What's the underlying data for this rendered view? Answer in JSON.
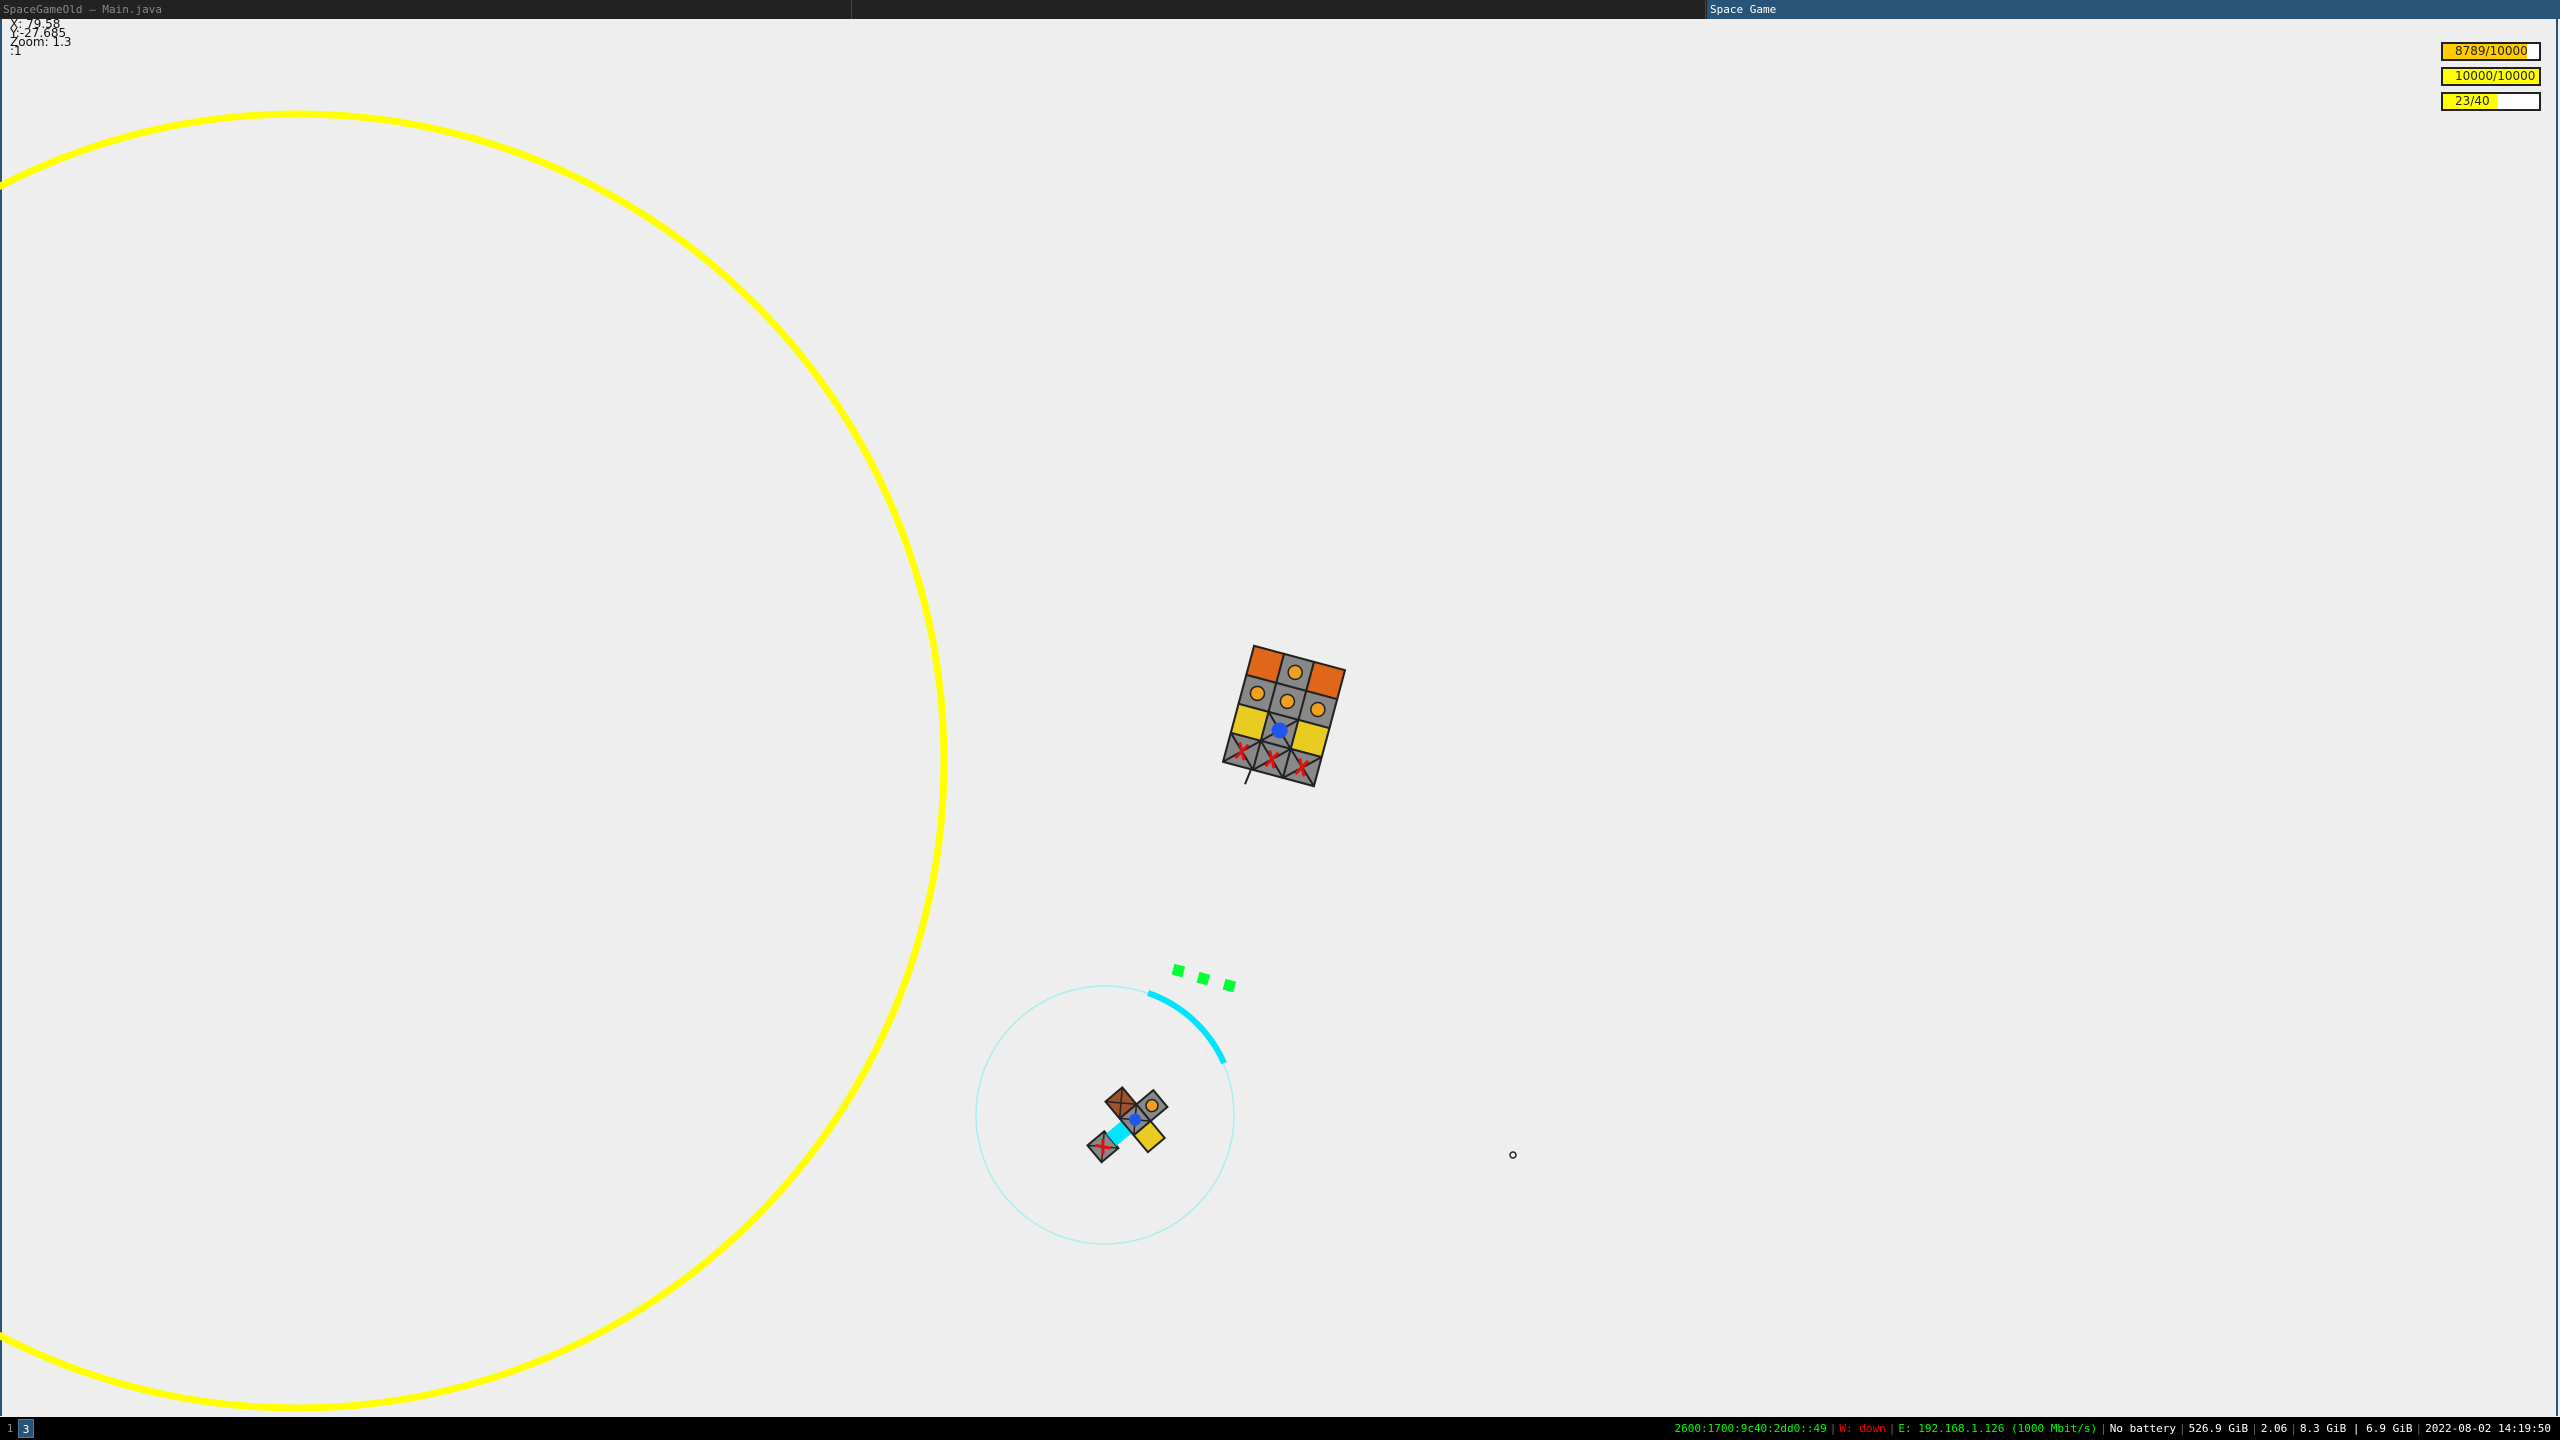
{
  "window": {
    "tabs": [
      {
        "label": "SpaceGameOld – Main.java",
        "active": false
      },
      {
        "label": "",
        "active": false
      },
      {
        "label": "Space Game",
        "active": true
      }
    ]
  },
  "hud": {
    "debug_lines": [
      "X: 79.58",
      "Y:-27.685",
      "Zoom: 1.3",
      ":1"
    ],
    "bars": [
      {
        "label": "8789/10000",
        "fraction": 0.8789,
        "color": "#ffcc00"
      },
      {
        "label": "10000/10000",
        "fraction": 1.0,
        "color": "#ffff00"
      },
      {
        "label": "23/40",
        "fraction": 0.575,
        "color": "#ffff00"
      }
    ]
  },
  "statusbar": {
    "workspaces": [
      "1",
      "3"
    ],
    "items": [
      {
        "text": "2600:1700:9c40:2dd0::49",
        "color": "#00ff00"
      },
      {
        "text": "W: down",
        "color": "#ff0000"
      },
      {
        "text": "E: 192.168.1.126 (1000 Mbit/s)",
        "color": "#00ff00"
      },
      {
        "text": "No battery",
        "color": "#ffffff"
      },
      {
        "text": "526.9 GiB",
        "color": "#ffffff"
      },
      {
        "text": "2.06",
        "color": "#ffffff"
      },
      {
        "text": "8.3 GiB | 6.9 GiB",
        "color": "#ffffff"
      },
      {
        "text": "2022-08-02 14:19:50",
        "color": "#ffffff"
      }
    ]
  },
  "colors": {
    "planet_ring": "#ffff00",
    "shield": "#00e5ff",
    "projectile": "#00ff33",
    "accent": "#285577"
  }
}
